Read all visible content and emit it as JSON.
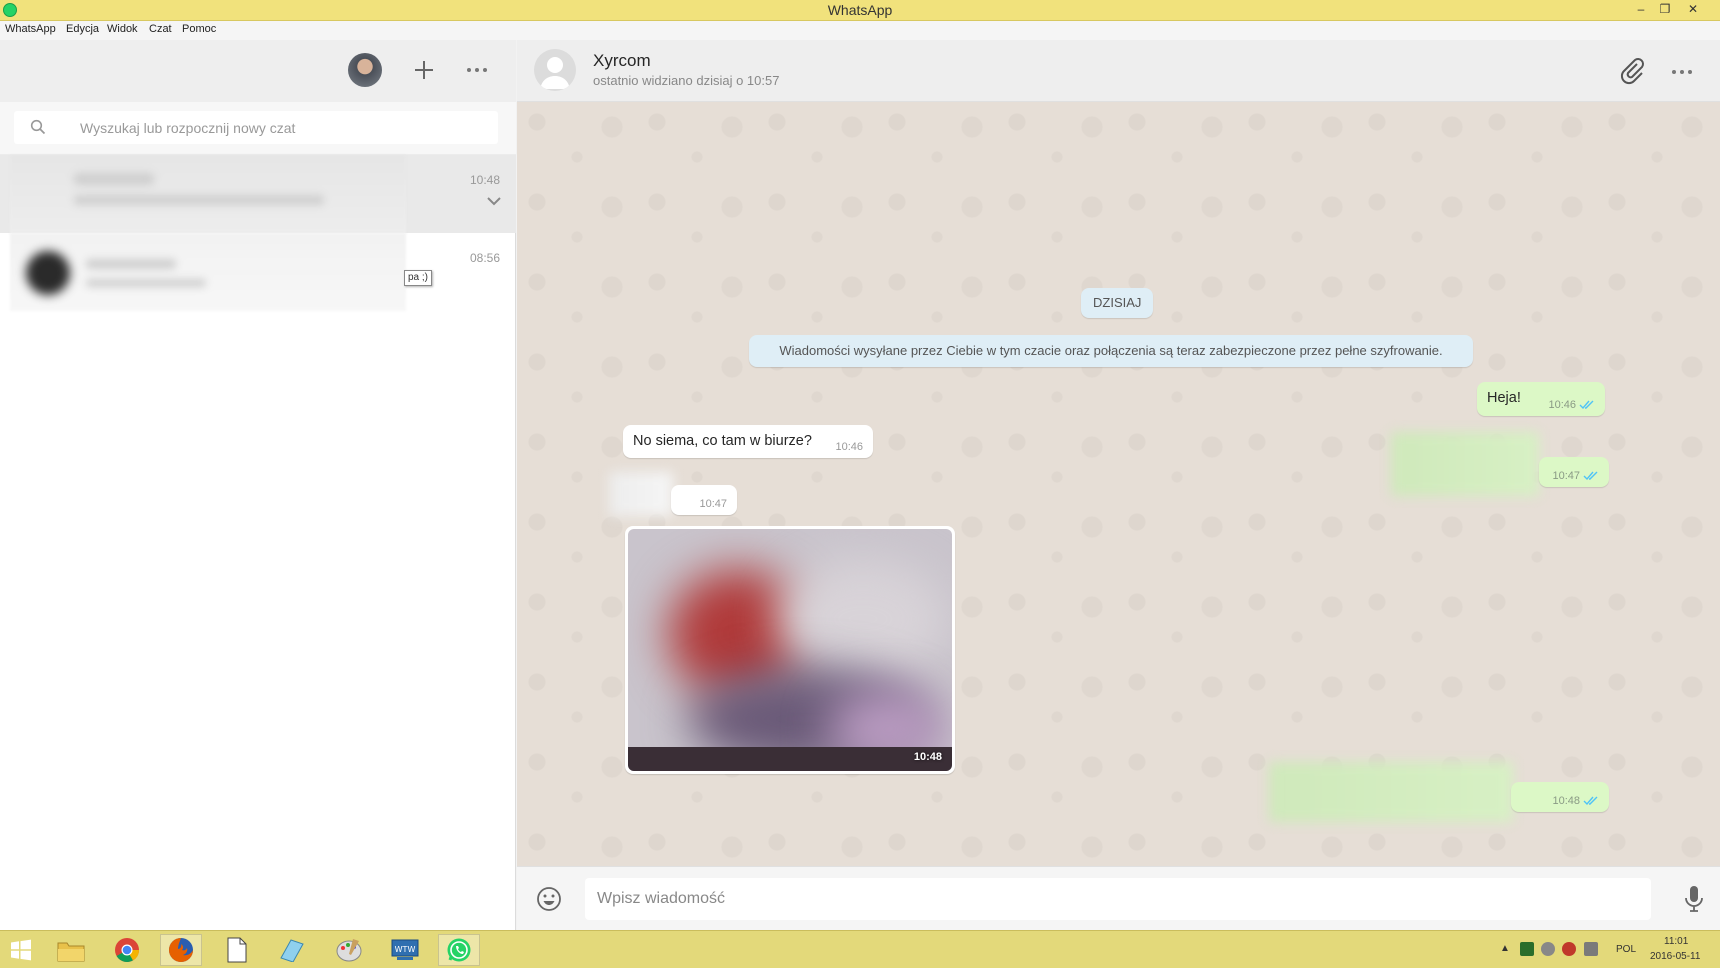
{
  "window": {
    "title": "WhatsApp"
  },
  "menu": [
    "WhatsApp",
    "Edycja",
    "Widok",
    "Czat",
    "Pomoc"
  ],
  "search": {
    "placeholder": "Wyszukaj lub rozpocznij nowy czat"
  },
  "chats": [
    {
      "time": "10:48",
      "active": true
    },
    {
      "time": "08:56",
      "active": false
    }
  ],
  "tooltip_fragment": "pa ;)",
  "conversation": {
    "contact_name": "Xyrcom",
    "contact_status": "ostatnio widziano dzisiaj o 10:57",
    "day_label": "DZISIAJ",
    "encryption_notice": "Wiadomości wysyłane przez Ciebie w tym czacie oraz połączenia są teraz zabezpieczone przez pełne szyfrowanie.",
    "messages": [
      {
        "direction": "out",
        "text": "Heja!",
        "time": "10:46",
        "status": "read"
      },
      {
        "direction": "in",
        "text": "No siema, co tam w biurze?",
        "time": "10:46"
      },
      {
        "direction": "out",
        "text": "",
        "time": "10:47",
        "status": "read",
        "blurred": true
      },
      {
        "direction": "in",
        "text": "",
        "time": "10:47",
        "blurred": true
      },
      {
        "direction": "in",
        "type": "image",
        "time": "10:48"
      },
      {
        "direction": "out",
        "text": "",
        "time": "10:48",
        "status": "read",
        "blurred": true
      }
    ]
  },
  "composer": {
    "placeholder": "Wpisz wiadomość"
  },
  "taskbar": {
    "apps": [
      "windows-start",
      "file-explorer",
      "chrome",
      "firefox",
      "document",
      "notepad",
      "paint",
      "wtw",
      "whatsapp"
    ],
    "active_app": "whatsapp",
    "language": "POL",
    "clock_time": "11:01",
    "clock_date": "2016-05-11"
  },
  "colors": {
    "outgoing_bubble": "#dcf8c6",
    "incoming_bubble": "#ffffff",
    "read_ticks": "#4fc3f7",
    "title_bar": "#f1e27c"
  }
}
